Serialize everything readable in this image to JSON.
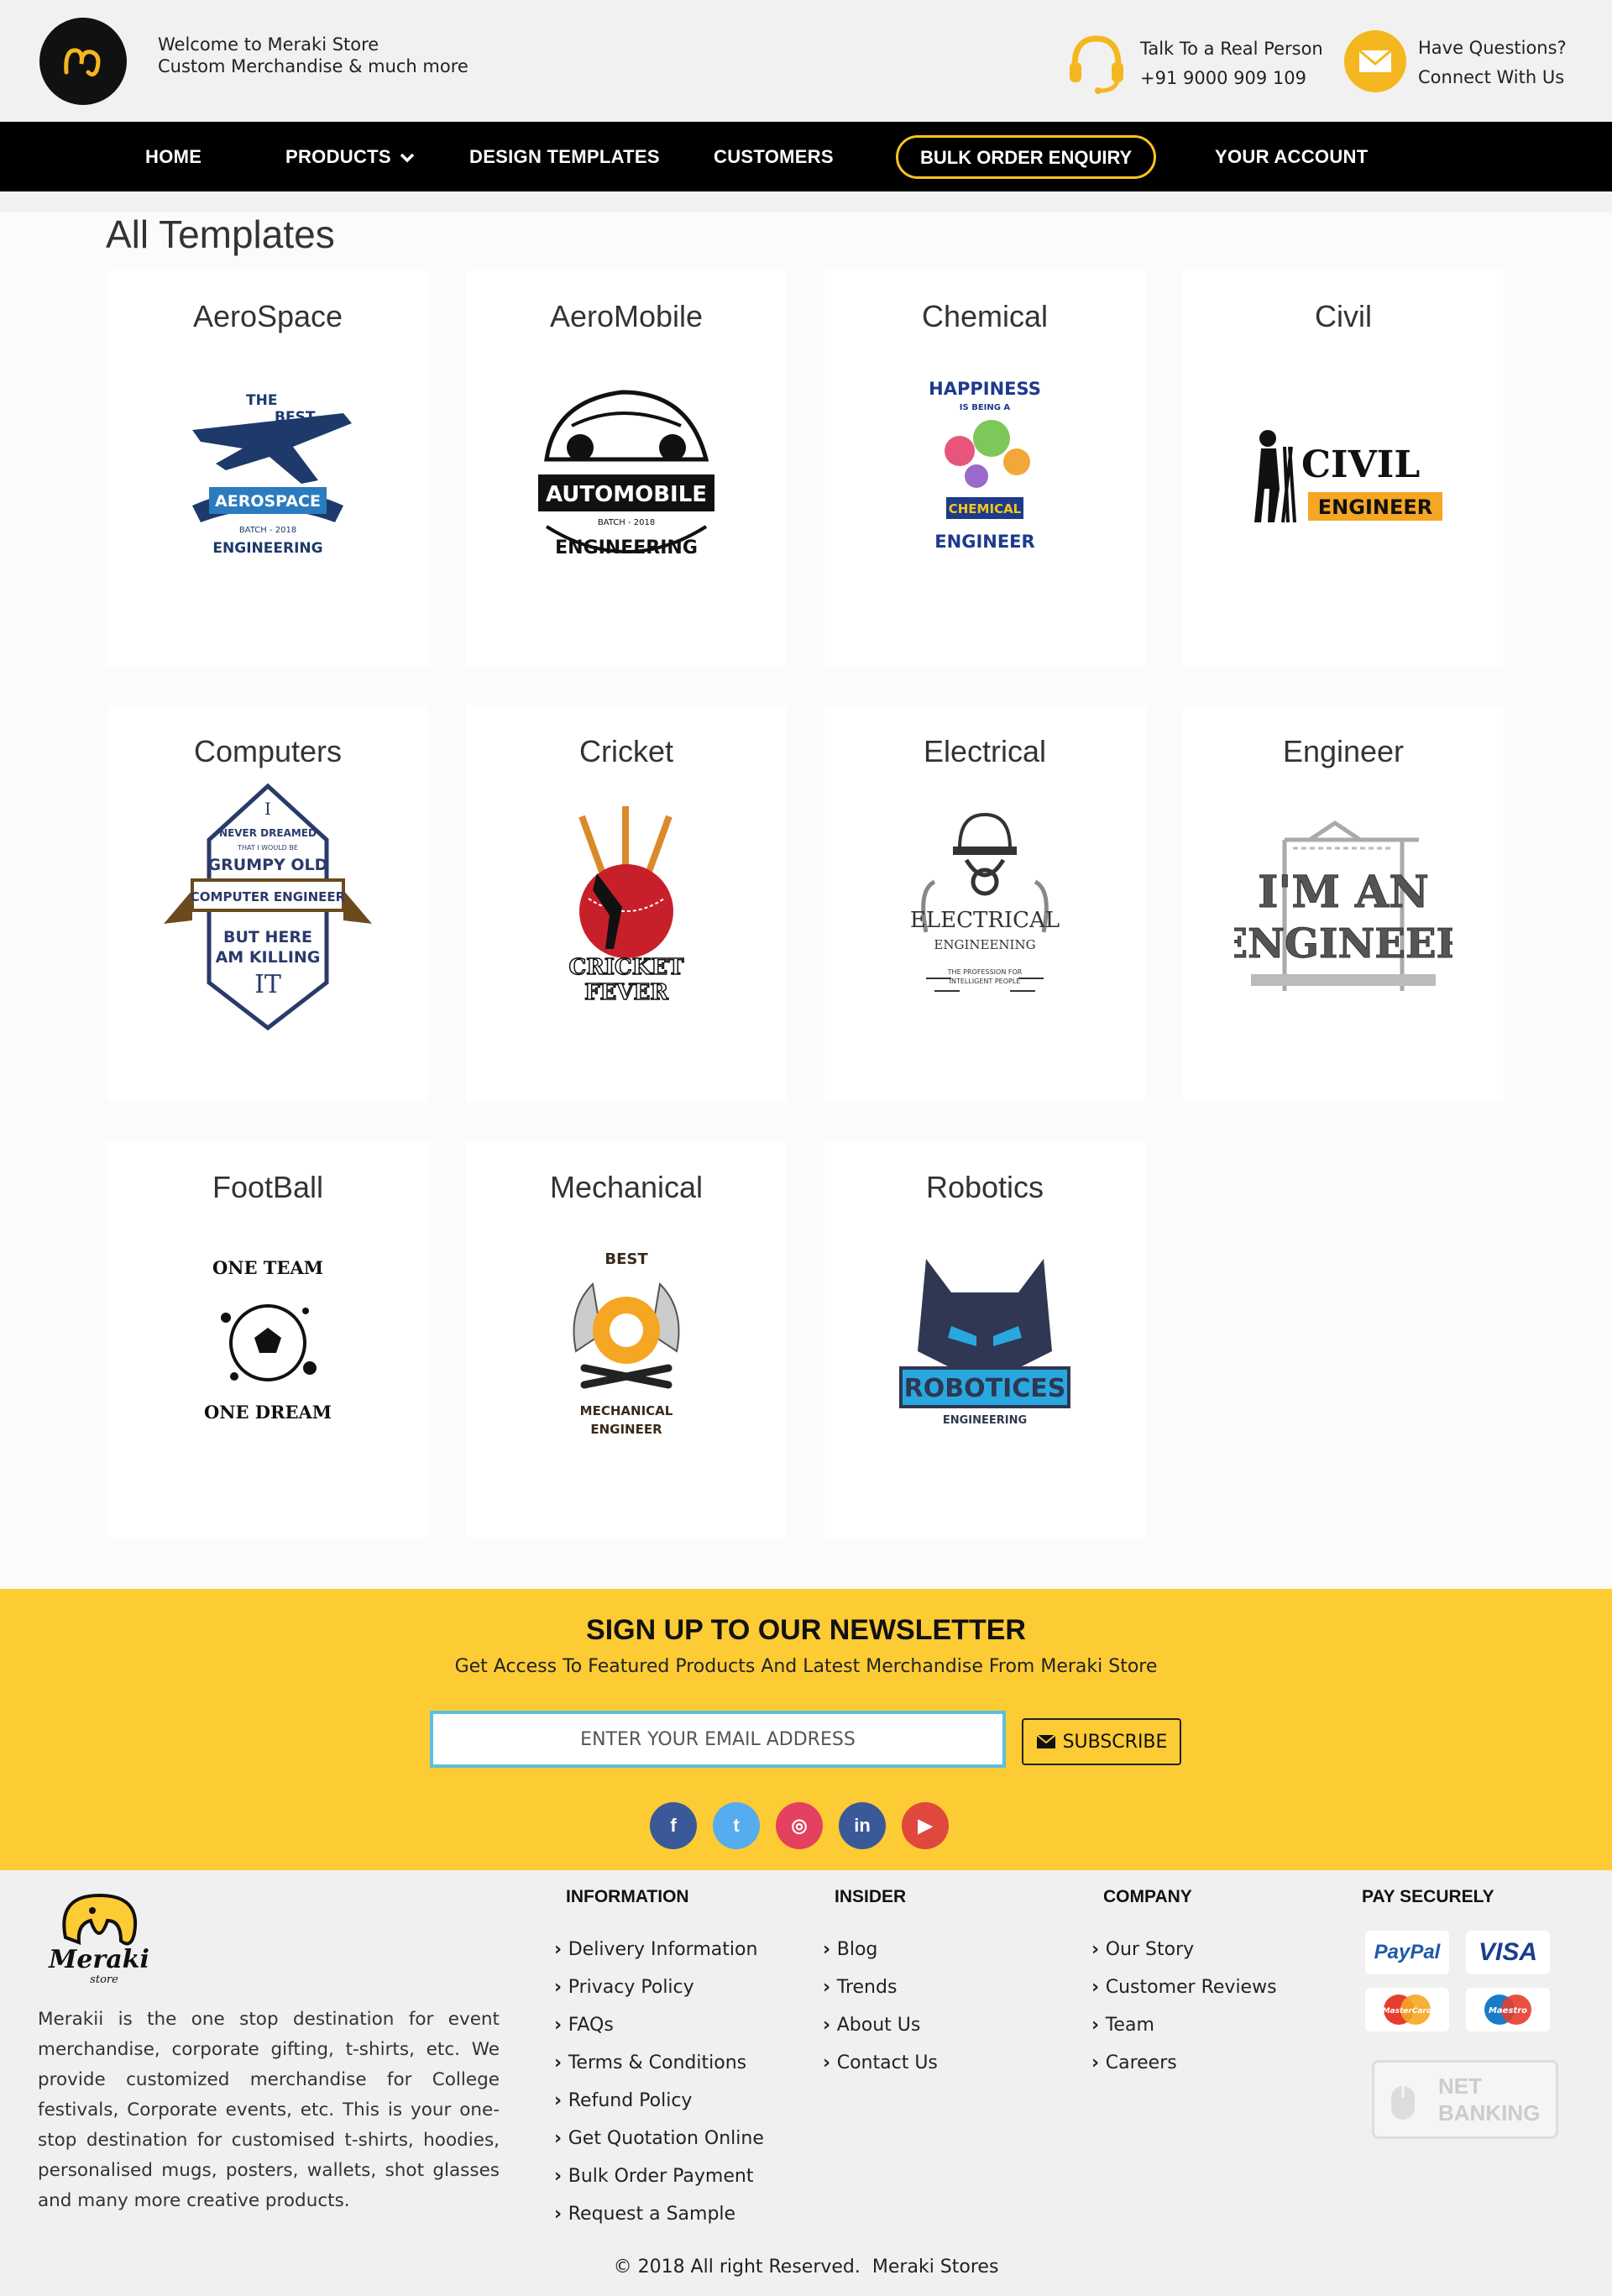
{
  "header": {
    "welcome_line1": "Welcome to Meraki Store",
    "welcome_line2": "Custom Merchandise & much more",
    "phone_label": "Talk To a Real Person",
    "phone_number": "+91 9000 909 109",
    "questions_label": "Have Questions?",
    "questions_sub": "Connect With Us"
  },
  "nav": {
    "home": "HOME",
    "products": "PRODUCTS",
    "design_templates": "DESIGN TEMPLATES",
    "customers": "CUSTOMERS",
    "bulk_order": "BULK ORDER ENQUIRY",
    "account": "YOUR ACCOUNT"
  },
  "main": {
    "title": "All Templates",
    "cards": [
      {
        "title": "AeroSpace",
        "art": [
          "THE",
          "BEST",
          "AEROSPACE",
          "BATCH - 2018",
          "ENGINEERING"
        ]
      },
      {
        "title": "AeroMobile",
        "art": [
          "AUTOMOBILE",
          "BATCH - 2018",
          "ENGINEERING"
        ]
      },
      {
        "title": "Chemical",
        "art": [
          "HAPPINESS",
          "IS BEING A",
          "CHEMICAL",
          "ENGINEER"
        ]
      },
      {
        "title": "Civil",
        "art": [
          "CIVIL",
          "ENGINEER"
        ]
      },
      {
        "title": "Computers",
        "art": [
          "I",
          "NEVER DREAMED",
          "THAT I WOULD BE",
          "GRUMPY OLD",
          "COMPUTER ENGINEER",
          "BUT HERE",
          "AM KILLING",
          "IT"
        ]
      },
      {
        "title": "Cricket",
        "art": [
          "CRICKET",
          "FEVER"
        ]
      },
      {
        "title": "Electrical",
        "art": [
          "ELECTRICAL",
          "ENGINEENING",
          "THE PROFESSION FOR",
          "INTELLIGENT PEOPLE"
        ]
      },
      {
        "title": "Engineer",
        "art": [
          "I'M AN",
          "ENGINEER"
        ]
      },
      {
        "title": "FootBall",
        "art": [
          "ONE TEAM",
          "ONE DREAM"
        ]
      },
      {
        "title": "Mechanical",
        "art": [
          "BEST",
          "MECHANICAL",
          "ENGINEER"
        ]
      },
      {
        "title": "Robotics",
        "art": [
          "ROBOTICES",
          "ENGINEERING"
        ]
      }
    ]
  },
  "newsletter": {
    "title": "SIGN UP TO OUR NEWSLETTER",
    "subtitle": "Get Access To Featured Products And Latest Merchandise From Meraki Store",
    "email_placeholder": "ENTER YOUR EMAIL ADDRESS",
    "subscribe": "SUBSCRIBE",
    "social": [
      {
        "name": "facebook-icon",
        "glyph": "f",
        "color": "#3b5998"
      },
      {
        "name": "twitter-icon",
        "glyph": "t",
        "color": "#55acee"
      },
      {
        "name": "instagram-icon",
        "glyph": "◎",
        "color": "#e4405f"
      },
      {
        "name": "linkedin-icon",
        "glyph": "in",
        "color": "#3b5998"
      },
      {
        "name": "youtube-icon",
        "glyph": "▶",
        "color": "#e0483e"
      }
    ]
  },
  "footer": {
    "brand": "Meraki",
    "brand_sub": "store",
    "about": "Merakii is the one stop destination for event merchandise, corporate gifting, t-shirts, etc. We provide customized merchandise for College festivals, Corporate events, etc. This is your one-stop destination for customised t-shirts, hoodies, personalised mugs, posters, wallets, shot glasses and many more creative products.",
    "information": {
      "heading": "INFORMATION",
      "links": [
        "Delivery Information",
        "Privacy Policy",
        "FAQs",
        "Terms & Conditions",
        "Refund Policy",
        "Get Quotation Online",
        "Bulk Order Payment",
        "Request a Sample"
      ]
    },
    "insider": {
      "heading": "INSIDER",
      "links": [
        "Blog",
        "Trends",
        "About Us",
        "Contact Us"
      ]
    },
    "company": {
      "heading": "COMPANY",
      "links": [
        "Our Story",
        "Customer Reviews",
        "Team",
        "Careers"
      ]
    },
    "pay": {
      "heading": "PAY SECURELY",
      "methods": [
        "PayPal",
        "VISA",
        "MasterCard",
        "Maestro"
      ],
      "netbanking": [
        "NET",
        "BANKING"
      ]
    },
    "copyright_text": "© 2018 All right Reserved.",
    "copyright_brand": "Meraki Stores"
  },
  "colors": {
    "accent": "#fdcb34",
    "nav_bg": "#000000",
    "bulk_border": "#f9c320"
  }
}
